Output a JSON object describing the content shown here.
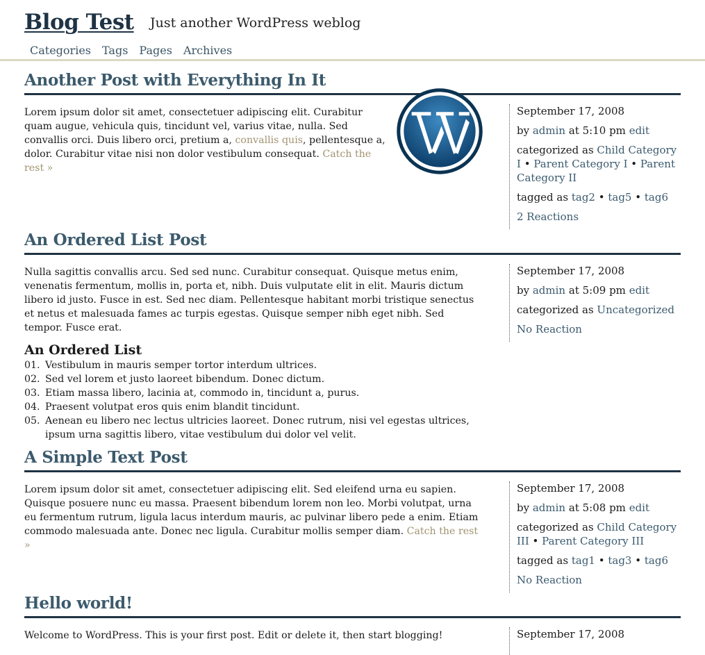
{
  "site": {
    "title": "Blog Test",
    "description": "Just another WordPress weblog",
    "nav": [
      "Categories",
      "Tags",
      "Pages",
      "Archives"
    ]
  },
  "posts": [
    {
      "title": "Another Post with Everything In It",
      "body_before": "Lorem ipsum dolor sit amet, consectetuer adipiscing elit. Curabitur quam augue, vehicula quis, tincidunt vel, varius vitae, nulla. Sed convallis orci. Duis libero orci, pretium a, ",
      "body_link": "convallis quis",
      "body_after": ", pellentesque a, dolor. Curabitur vitae nisi non dolor vestibulum consequat. ",
      "more_link": "Catch the rest »",
      "date": "September 17, 2008",
      "by_prefix": "by",
      "author": "admin",
      "time": "at 5:10 pm",
      "edit": "edit",
      "cat_prefix": "categorized as",
      "categories": [
        "Child Category I",
        "Parent Category I",
        "Parent Category II"
      ],
      "tag_prefix": "tagged as",
      "tags": [
        "tag2",
        "tag5",
        "tag6"
      ],
      "reactions": "2 Reactions",
      "image_icon": "wordpress-logo-icon"
    },
    {
      "title": "An Ordered List Post",
      "body": "Nulla sagittis convallis arcu. Sed sed nunc. Curabitur consequat. Quisque metus enim, venenatis fermentum, mollis in, porta et, nibh. Duis vulputate elit in elit. Mauris dictum libero id justo. Fusce in est. Sed nec diam. Pellentesque habitant morbi tristique senectus et netus et malesuada fames ac turpis egestas. Quisque semper nibh eget nibh. Sed tempor. Fusce erat.",
      "list_heading": "An Ordered List",
      "list_items": [
        {
          "num": "01.",
          "text": "Vestibulum in mauris semper tortor interdum ultrices."
        },
        {
          "num": "02.",
          "text": "Sed vel lorem et justo laoreet bibendum. Donec dictum."
        },
        {
          "num": "03.",
          "text": "Etiam massa libero, lacinia at, commodo in, tincidunt a, purus."
        },
        {
          "num": "04.",
          "text": "Praesent volutpat eros quis enim blandit tincidunt."
        },
        {
          "num": "05.",
          "text": "Aenean eu libero nec lectus ultricies laoreet. Donec rutrum, nisi vel egestas ultrices, ipsum urna sagittis libero, vitae vestibulum dui dolor vel velit."
        }
      ],
      "date": "September 17, 2008",
      "by_prefix": "by",
      "author": "admin",
      "time": "at 5:09 pm",
      "edit": "edit",
      "cat_prefix": "categorized as",
      "categories": [
        "Uncategorized"
      ],
      "reactions": "No Reaction"
    },
    {
      "title": "A Simple Text Post",
      "body": "Lorem ipsum dolor sit amet, consectetuer adipiscing elit. Sed eleifend urna eu sapien. Quisque posuere nunc eu massa. Praesent bibendum lorem non leo. Morbi volutpat, urna eu fermentum rutrum, ligula lacus interdum mauris, ac pulvinar libero pede a enim. Etiam commodo malesuada ante. Donec nec ligula. Curabitur mollis semper diam. ",
      "more_link": "Catch the rest »",
      "date": "September 17, 2008",
      "by_prefix": "by",
      "author": "admin",
      "time": "at 5:08 pm",
      "edit": "edit",
      "cat_prefix": "categorized as",
      "categories": [
        "Child Category III",
        "Parent Category III"
      ],
      "tag_prefix": "tagged as",
      "tags": [
        "tag1",
        "tag3",
        "tag6"
      ],
      "reactions": "No Reaction"
    },
    {
      "title": "Hello world!",
      "body": "Welcome to WordPress. This is your first post. Edit or delete it, then start blogging!",
      "date": "September 17, 2008"
    }
  ],
  "colors": {
    "title": "#3c5a6c",
    "rule": "#1f3344",
    "link": "#3b5a6e",
    "more_link": "#a19270",
    "header_rule": "#d8d8c4"
  }
}
